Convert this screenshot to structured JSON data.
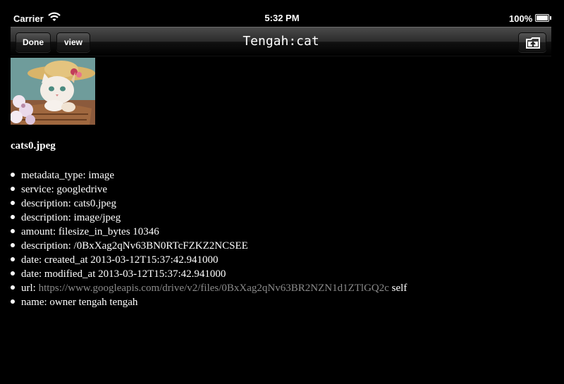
{
  "status": {
    "carrier": "Carrier",
    "time": "5:32 PM",
    "battery": "100%"
  },
  "nav": {
    "done_label": "Done",
    "view_label": "view",
    "title": "Tengah:cat",
    "folder_icon": "folder-upload-icon"
  },
  "file": {
    "name": "cats0.jpeg",
    "metadata": [
      {
        "text": "metadata_type: image"
      },
      {
        "text": "service: googledrive"
      },
      {
        "text": "description: cats0.jpeg"
      },
      {
        "text": "description: image/jpeg"
      },
      {
        "text": "amount: filesize_in_bytes 10346"
      },
      {
        "text": "description: /0BxXag2qNv63BN0RTcFZKZ2NCSEE"
      },
      {
        "text": "date: created_at 2013-03-12T15:37:42.941000"
      },
      {
        "text": "date: modified_at 2013-03-12T15:37:42.941000"
      },
      {
        "prefix": "url: ",
        "link": "https://www.googleapis.com/drive/v2/files/0BxXag2qNv63BR2NZN1d1ZTlGQ2c",
        "suffix": " self"
      },
      {
        "text": "name: owner tengah tengah"
      }
    ]
  },
  "colors": {
    "background": "#000000",
    "link": "#8a8a8a"
  }
}
